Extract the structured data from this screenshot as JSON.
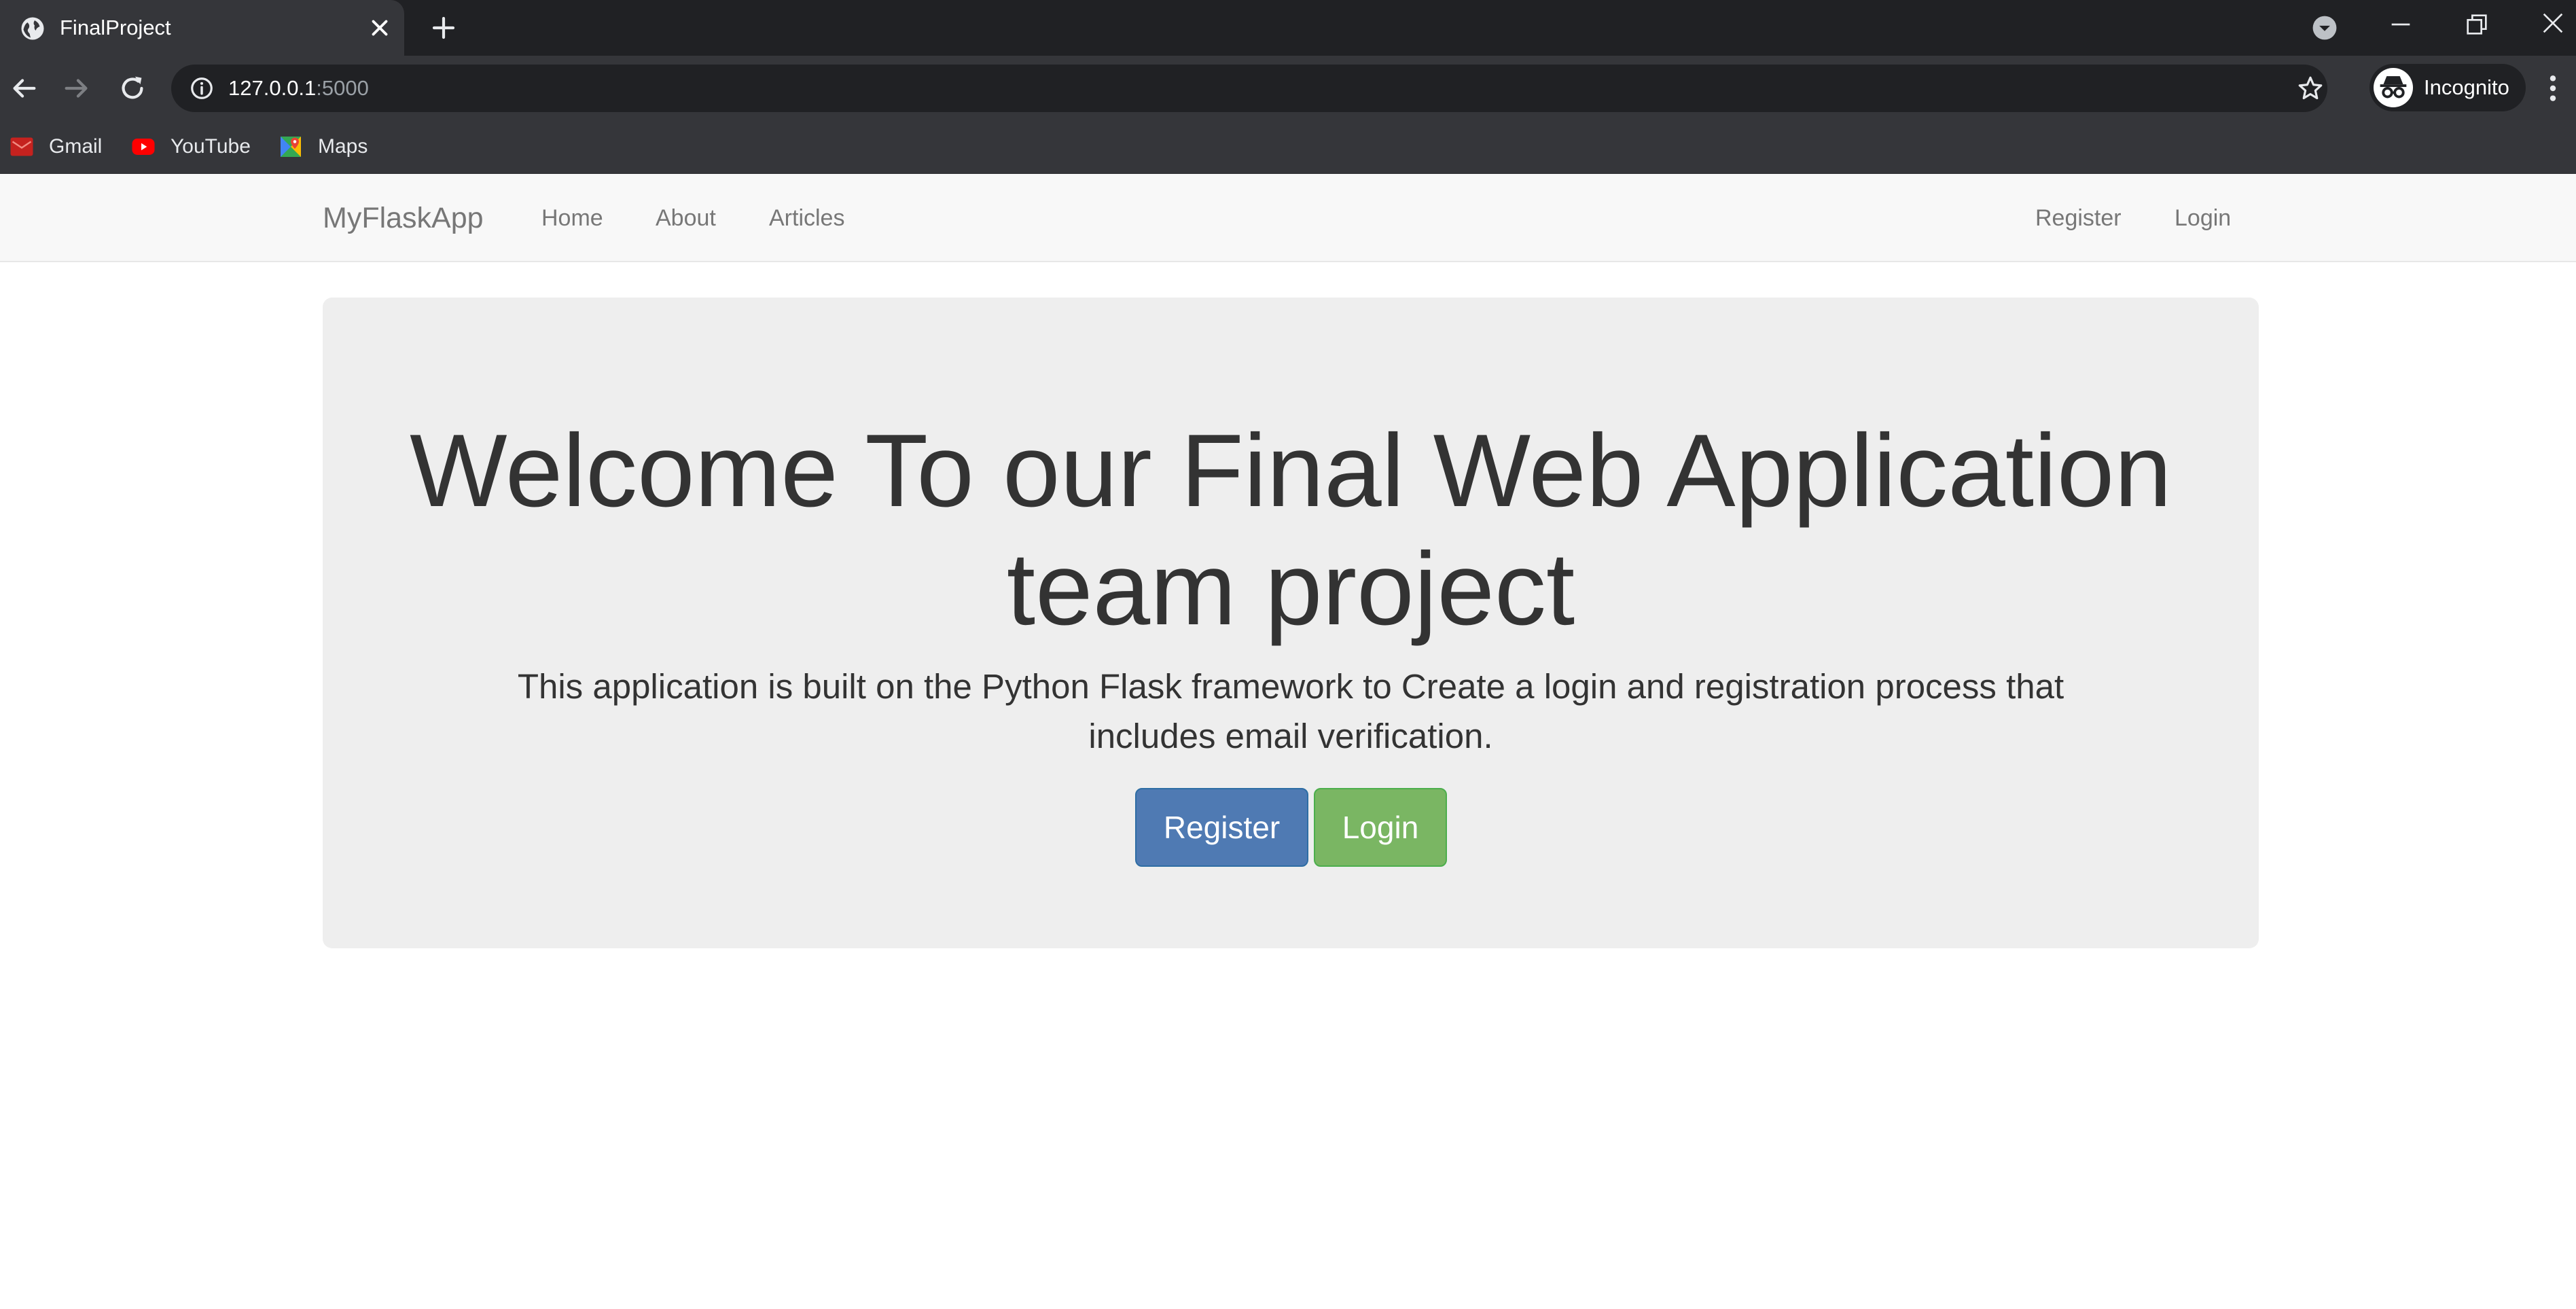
{
  "browser": {
    "tab": {
      "title": "FinalProject",
      "favicon": "globe-icon"
    },
    "url": {
      "host": "127.0.0.1",
      "port": ":5000"
    },
    "profile": {
      "label": "Incognito",
      "icon": "incognito-icon"
    },
    "bookmarks": [
      {
        "label": "Gmail",
        "icon": "gmail-icon"
      },
      {
        "label": "YouTube",
        "icon": "youtube-icon"
      },
      {
        "label": "Maps",
        "icon": "maps-icon"
      }
    ]
  },
  "navbar": {
    "brand": "MyFlaskApp",
    "left_links": [
      "Home",
      "About",
      "Articles"
    ],
    "right_links": [
      "Register",
      "Login"
    ]
  },
  "jumbotron": {
    "heading": "Welcome To our Final Web Application team project",
    "lead": "This application is built on the Python Flask framework to Create a login and registration process that includes email verification.",
    "register_label": "Register",
    "login_label": "Login"
  },
  "colors": {
    "chrome_dark": "#202124",
    "chrome_toolbar": "#35363a",
    "navbar_bg": "#f8f8f8",
    "jumbotron_bg": "#eeeeee",
    "primary": "#4f7ab3",
    "success": "#7ab663"
  }
}
